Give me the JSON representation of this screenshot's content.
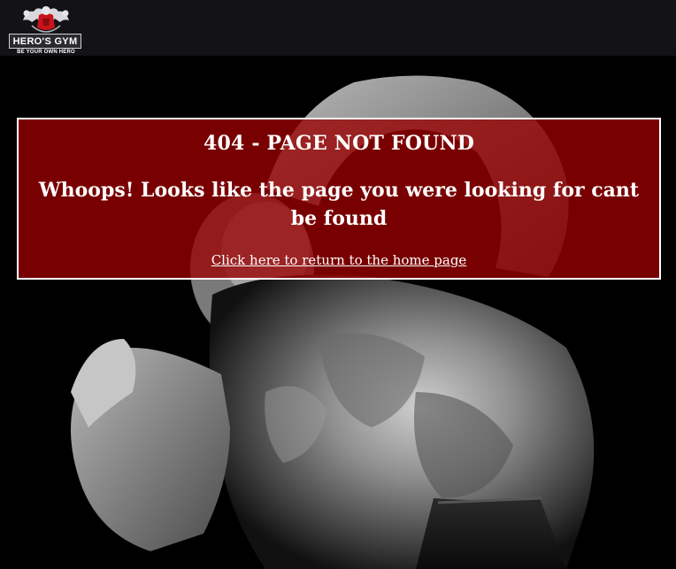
{
  "header": {
    "logo": {
      "title": "HERO'S GYM",
      "tagline": "BE YOUR OWN HERO",
      "icon": "muscle-man-icon"
    }
  },
  "error": {
    "code_text": "404 - PAGE NOT FOUND",
    "message": "Whoops! Looks like the page you were looking for cant be found",
    "home_link_label": "Click here to return to the home page"
  },
  "colors": {
    "header_bg": "#121217",
    "panel_bg": "#9b0000",
    "panel_border": "#ffffff",
    "text": "#ffffff"
  }
}
